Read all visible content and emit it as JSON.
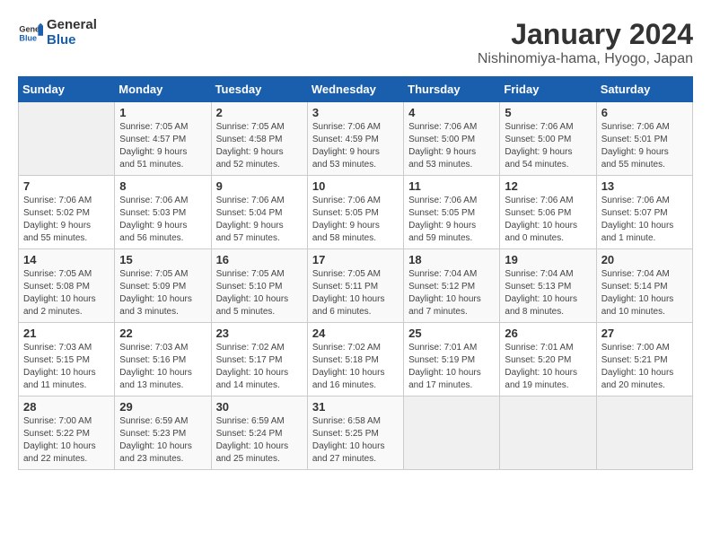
{
  "header": {
    "logo_general": "General",
    "logo_blue": "Blue",
    "title": "January 2024",
    "subtitle": "Nishinomiya-hama, Hyogo, Japan"
  },
  "calendar": {
    "weekdays": [
      "Sunday",
      "Monday",
      "Tuesday",
      "Wednesday",
      "Thursday",
      "Friday",
      "Saturday"
    ],
    "weeks": [
      [
        {
          "day": "",
          "info": ""
        },
        {
          "day": "1",
          "info": "Sunrise: 7:05 AM\nSunset: 4:57 PM\nDaylight: 9 hours\nand 51 minutes."
        },
        {
          "day": "2",
          "info": "Sunrise: 7:05 AM\nSunset: 4:58 PM\nDaylight: 9 hours\nand 52 minutes."
        },
        {
          "day": "3",
          "info": "Sunrise: 7:06 AM\nSunset: 4:59 PM\nDaylight: 9 hours\nand 53 minutes."
        },
        {
          "day": "4",
          "info": "Sunrise: 7:06 AM\nSunset: 5:00 PM\nDaylight: 9 hours\nand 53 minutes."
        },
        {
          "day": "5",
          "info": "Sunrise: 7:06 AM\nSunset: 5:00 PM\nDaylight: 9 hours\nand 54 minutes."
        },
        {
          "day": "6",
          "info": "Sunrise: 7:06 AM\nSunset: 5:01 PM\nDaylight: 9 hours\nand 55 minutes."
        }
      ],
      [
        {
          "day": "7",
          "info": "Sunrise: 7:06 AM\nSunset: 5:02 PM\nDaylight: 9 hours\nand 55 minutes."
        },
        {
          "day": "8",
          "info": "Sunrise: 7:06 AM\nSunset: 5:03 PM\nDaylight: 9 hours\nand 56 minutes."
        },
        {
          "day": "9",
          "info": "Sunrise: 7:06 AM\nSunset: 5:04 PM\nDaylight: 9 hours\nand 57 minutes."
        },
        {
          "day": "10",
          "info": "Sunrise: 7:06 AM\nSunset: 5:05 PM\nDaylight: 9 hours\nand 58 minutes."
        },
        {
          "day": "11",
          "info": "Sunrise: 7:06 AM\nSunset: 5:05 PM\nDaylight: 9 hours\nand 59 minutes."
        },
        {
          "day": "12",
          "info": "Sunrise: 7:06 AM\nSunset: 5:06 PM\nDaylight: 10 hours\nand 0 minutes."
        },
        {
          "day": "13",
          "info": "Sunrise: 7:06 AM\nSunset: 5:07 PM\nDaylight: 10 hours\nand 1 minute."
        }
      ],
      [
        {
          "day": "14",
          "info": "Sunrise: 7:05 AM\nSunset: 5:08 PM\nDaylight: 10 hours\nand 2 minutes."
        },
        {
          "day": "15",
          "info": "Sunrise: 7:05 AM\nSunset: 5:09 PM\nDaylight: 10 hours\nand 3 minutes."
        },
        {
          "day": "16",
          "info": "Sunrise: 7:05 AM\nSunset: 5:10 PM\nDaylight: 10 hours\nand 5 minutes."
        },
        {
          "day": "17",
          "info": "Sunrise: 7:05 AM\nSunset: 5:11 PM\nDaylight: 10 hours\nand 6 minutes."
        },
        {
          "day": "18",
          "info": "Sunrise: 7:04 AM\nSunset: 5:12 PM\nDaylight: 10 hours\nand 7 minutes."
        },
        {
          "day": "19",
          "info": "Sunrise: 7:04 AM\nSunset: 5:13 PM\nDaylight: 10 hours\nand 8 minutes."
        },
        {
          "day": "20",
          "info": "Sunrise: 7:04 AM\nSunset: 5:14 PM\nDaylight: 10 hours\nand 10 minutes."
        }
      ],
      [
        {
          "day": "21",
          "info": "Sunrise: 7:03 AM\nSunset: 5:15 PM\nDaylight: 10 hours\nand 11 minutes."
        },
        {
          "day": "22",
          "info": "Sunrise: 7:03 AM\nSunset: 5:16 PM\nDaylight: 10 hours\nand 13 minutes."
        },
        {
          "day": "23",
          "info": "Sunrise: 7:02 AM\nSunset: 5:17 PM\nDaylight: 10 hours\nand 14 minutes."
        },
        {
          "day": "24",
          "info": "Sunrise: 7:02 AM\nSunset: 5:18 PM\nDaylight: 10 hours\nand 16 minutes."
        },
        {
          "day": "25",
          "info": "Sunrise: 7:01 AM\nSunset: 5:19 PM\nDaylight: 10 hours\nand 17 minutes."
        },
        {
          "day": "26",
          "info": "Sunrise: 7:01 AM\nSunset: 5:20 PM\nDaylight: 10 hours\nand 19 minutes."
        },
        {
          "day": "27",
          "info": "Sunrise: 7:00 AM\nSunset: 5:21 PM\nDaylight: 10 hours\nand 20 minutes."
        }
      ],
      [
        {
          "day": "28",
          "info": "Sunrise: 7:00 AM\nSunset: 5:22 PM\nDaylight: 10 hours\nand 22 minutes."
        },
        {
          "day": "29",
          "info": "Sunrise: 6:59 AM\nSunset: 5:23 PM\nDaylight: 10 hours\nand 23 minutes."
        },
        {
          "day": "30",
          "info": "Sunrise: 6:59 AM\nSunset: 5:24 PM\nDaylight: 10 hours\nand 25 minutes."
        },
        {
          "day": "31",
          "info": "Sunrise: 6:58 AM\nSunset: 5:25 PM\nDaylight: 10 hours\nand 27 minutes."
        },
        {
          "day": "",
          "info": ""
        },
        {
          "day": "",
          "info": ""
        },
        {
          "day": "",
          "info": ""
        }
      ]
    ]
  }
}
